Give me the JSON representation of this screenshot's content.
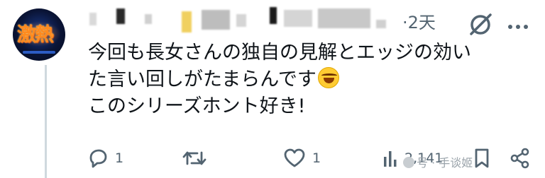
{
  "post": {
    "timestamp": "·2天",
    "avatar_text": "激熱",
    "lines": [
      "今回も長女さんの独自の見解とエッジの効い",
      "た言い回しがたまらんです",
      "このシリーズホント好き!"
    ],
    "emoji_icon": "rolling-on-floor-laughing-icon"
  },
  "actions": {
    "reply_count": "1",
    "like_count": "1",
    "views_count": "2,141"
  },
  "watermark": "号 · 手谈姬",
  "colors": {
    "text": "#0f1419",
    "secondary": "#536471",
    "thread_line": "#cfd9de"
  }
}
